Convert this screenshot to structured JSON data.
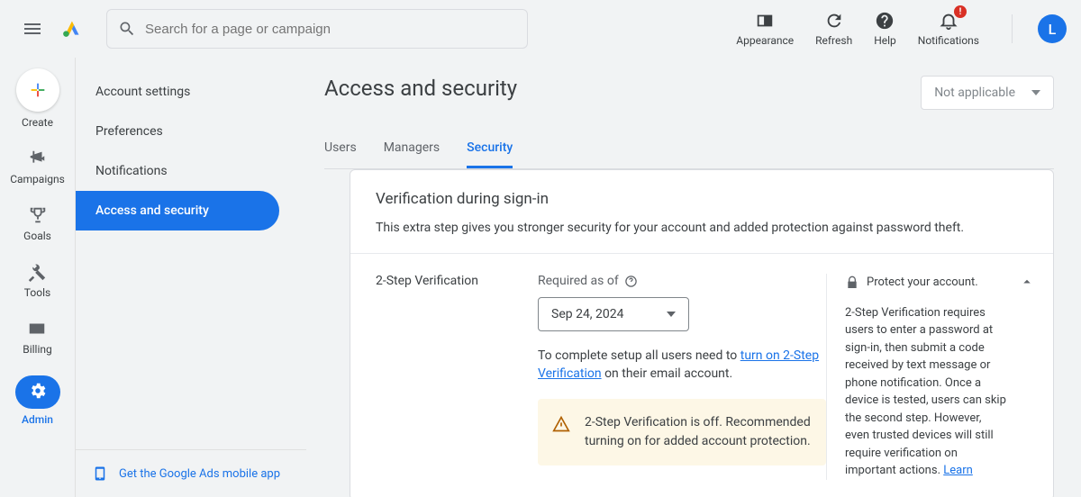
{
  "search": {
    "placeholder": "Search for a page or campaign"
  },
  "topActions": {
    "appearance": "Appearance",
    "refresh": "Refresh",
    "help": "Help",
    "notifications": "Notifications",
    "notificationBadge": "!"
  },
  "avatar": {
    "initial": "L"
  },
  "leftRail": {
    "create": "Create",
    "campaigns": "Campaigns",
    "goals": "Goals",
    "tools": "Tools",
    "billing": "Billing",
    "admin": "Admin"
  },
  "sidebar": {
    "items": [
      {
        "label": "Account settings"
      },
      {
        "label": "Preferences"
      },
      {
        "label": "Notifications"
      },
      {
        "label": "Access and security"
      }
    ]
  },
  "mobileApp": {
    "linkText": "Get the Google Ads mobile app"
  },
  "page": {
    "title": "Access and security",
    "notApplicable": "Not applicable"
  },
  "tabs": {
    "users": "Users",
    "managers": "Managers",
    "security": "Security"
  },
  "card": {
    "title": "Verification during sign-in",
    "description": "This extra step gives you stronger security for your account and added protection against password theft.",
    "twoStepLabel": "2-Step Verification",
    "requiredAsOf": "Required as of",
    "dateValue": "Sep 24, 2024",
    "setupPrefix": "To complete setup all users need to ",
    "setupLink": "turn on 2-Step Verification",
    "setupSuffix": " on their email account.",
    "warning": "2-Step Verification is off. Recommended turning on for added account protection.",
    "protectTitle": "Protect your account.",
    "protectBody": "2-Step Verification requires users to enter a password at sign-in, then submit a code received by text message or phone notification. Once a device is tested, users can skip the second step. However, even trusted devices will still require verification on important actions. ",
    "learn": "Learn"
  }
}
